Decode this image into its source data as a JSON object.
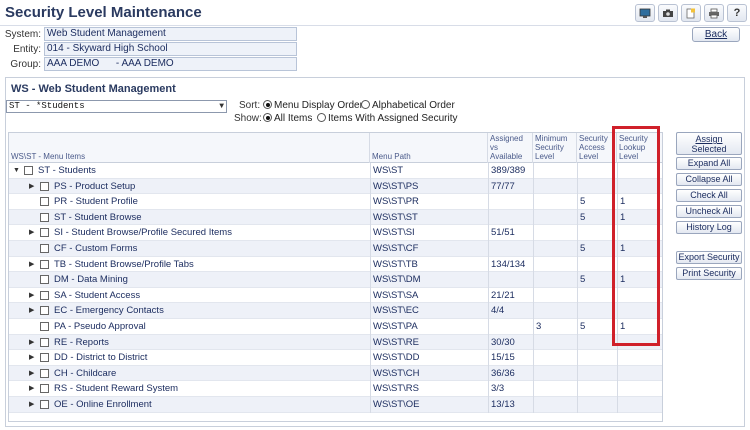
{
  "title": "Security Level Maintenance",
  "top_icons": [
    "monitor-icon",
    "camera-icon",
    "notes-icon",
    "print-icon",
    "help-icon"
  ],
  "info": {
    "system_label": "System:",
    "system_value": "Web Student Management",
    "entity_label": "Entity:",
    "entity_value": "014 - Skyward High School",
    "group_label": "Group:",
    "group_value": "AAA DEMO      - AAA DEMO"
  },
  "back_label": "Back",
  "section": {
    "title": "WS - Web Student Management",
    "menu_select": "ST - *Students",
    "sort_label": "Sort:",
    "sort_options": [
      "Menu Display Order",
      "Alphabetical Order"
    ],
    "sort_selected": 0,
    "show_label": "Show:",
    "show_options": [
      "All Items",
      "Items With Assigned Security"
    ],
    "show_selected": 0
  },
  "grid": {
    "columns": {
      "menu_items": "WS\\ST - Menu Items",
      "menu_path": "Menu Path",
      "assigned": "Assigned vs Available",
      "min_security": "Minimum Security Level",
      "access": "Security Access Level",
      "lookup": "Security Lookup Level"
    },
    "rows": [
      {
        "expander": "down",
        "indent": 0,
        "label": "ST - Students",
        "path": "WS\\ST",
        "assigned": "389/389",
        "min": "",
        "access": "",
        "lookup": ""
      },
      {
        "expander": "right",
        "indent": 1,
        "label": "PS - Product Setup",
        "path": "WS\\ST\\PS",
        "assigned": "77/77",
        "min": "",
        "access": "",
        "lookup": ""
      },
      {
        "expander": "",
        "indent": 1,
        "label": "PR - Student Profile",
        "path": "WS\\ST\\PR",
        "assigned": "",
        "min": "",
        "access": "5",
        "lookup": "1"
      },
      {
        "expander": "",
        "indent": 1,
        "label": "ST - Student Browse",
        "path": "WS\\ST\\ST",
        "assigned": "",
        "min": "",
        "access": "5",
        "lookup": "1"
      },
      {
        "expander": "right",
        "indent": 1,
        "label": "SI - Student Browse/Profile Secured Items",
        "path": "WS\\ST\\SI",
        "assigned": "51/51",
        "min": "",
        "access": "",
        "lookup": ""
      },
      {
        "expander": "",
        "indent": 1,
        "label": "CF - Custom Forms",
        "path": "WS\\ST\\CF",
        "assigned": "",
        "min": "",
        "access": "5",
        "lookup": "1"
      },
      {
        "expander": "right",
        "indent": 1,
        "label": "TB - Student Browse/Profile Tabs",
        "path": "WS\\ST\\TB",
        "assigned": "134/134",
        "min": "",
        "access": "",
        "lookup": ""
      },
      {
        "expander": "",
        "indent": 1,
        "label": "DM - Data Mining",
        "path": "WS\\ST\\DM",
        "assigned": "",
        "min": "",
        "access": "5",
        "lookup": "1"
      },
      {
        "expander": "right",
        "indent": 1,
        "label": "SA - Student Access",
        "path": "WS\\ST\\SA",
        "assigned": "21/21",
        "min": "",
        "access": "",
        "lookup": ""
      },
      {
        "expander": "right",
        "indent": 1,
        "label": "EC - Emergency Contacts",
        "path": "WS\\ST\\EC",
        "assigned": "4/4",
        "min": "",
        "access": "",
        "lookup": ""
      },
      {
        "expander": "",
        "indent": 1,
        "label": "PA - Pseudo Approval",
        "path": "WS\\ST\\PA",
        "assigned": "",
        "min": "3",
        "access": "5",
        "lookup": "1"
      },
      {
        "expander": "right",
        "indent": 1,
        "label": "RE - Reports",
        "path": "WS\\ST\\RE",
        "assigned": "30/30",
        "min": "",
        "access": "",
        "lookup": ""
      },
      {
        "expander": "right",
        "indent": 1,
        "label": "DD - District to District",
        "path": "WS\\ST\\DD",
        "assigned": "15/15",
        "min": "",
        "access": "",
        "lookup": ""
      },
      {
        "expander": "right",
        "indent": 1,
        "label": "CH - Childcare",
        "path": "WS\\ST\\CH",
        "assigned": "36/36",
        "min": "",
        "access": "",
        "lookup": ""
      },
      {
        "expander": "right",
        "indent": 1,
        "label": "RS - Student Reward System",
        "path": "WS\\ST\\RS",
        "assigned": "3/3",
        "min": "",
        "access": "",
        "lookup": ""
      },
      {
        "expander": "right",
        "indent": 1,
        "label": "OE - Online Enrollment",
        "path": "WS\\ST\\OE",
        "assigned": "13/13",
        "min": "",
        "access": "",
        "lookup": ""
      }
    ]
  },
  "side_buttons": {
    "assign_line1": "Assign",
    "assign_line2": "Selected",
    "expand_all": "Expand All",
    "collapse_all": "Collapse All",
    "check_all": "Check All",
    "uncheck_all": "Uncheck All",
    "history_log": "History Log",
    "export_security": "Export Security",
    "print_security": "Print Security"
  },
  "colors": {
    "highlight_border": "#d0202a",
    "alt_row": "#eef1f8",
    "header_text": "#4a5a8a"
  }
}
